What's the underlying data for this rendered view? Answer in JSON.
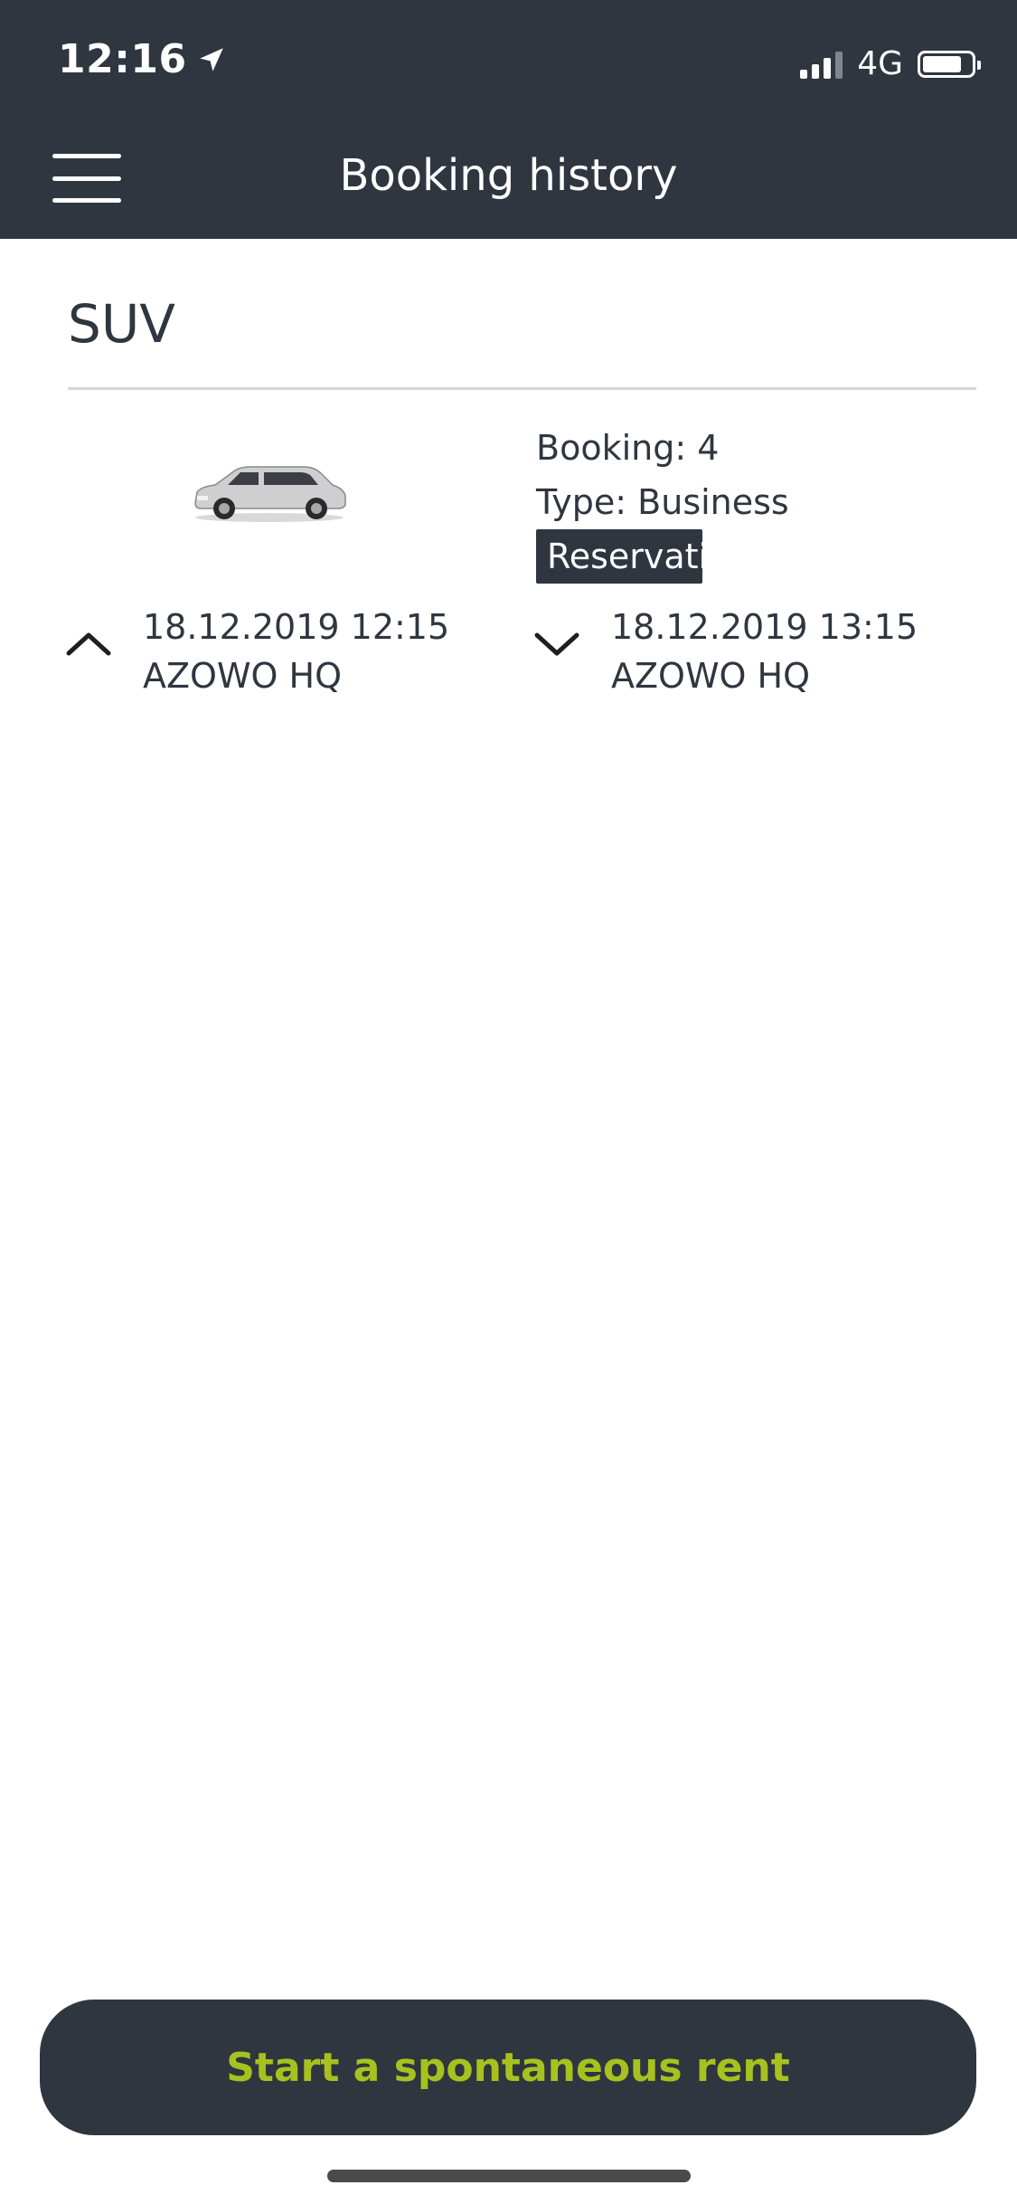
{
  "status_bar": {
    "time": "12:16",
    "network": "4G",
    "battery_percent": 75
  },
  "header": {
    "title": "Booking history",
    "background": "#2f3640"
  },
  "booking": {
    "category": "SUV",
    "booking_label": "Booking: 4",
    "type_label": "Type: Business",
    "badge": "Reservation",
    "pickup": {
      "datetime": "18.12.2019 12:15",
      "location": "AZOWO HQ"
    },
    "return": {
      "datetime": "18.12.2019 13:15",
      "location": "AZOWO HQ"
    }
  },
  "footer": {
    "button_label": "Start a spontaneous rent",
    "button_text_color": "#a7c21e"
  }
}
